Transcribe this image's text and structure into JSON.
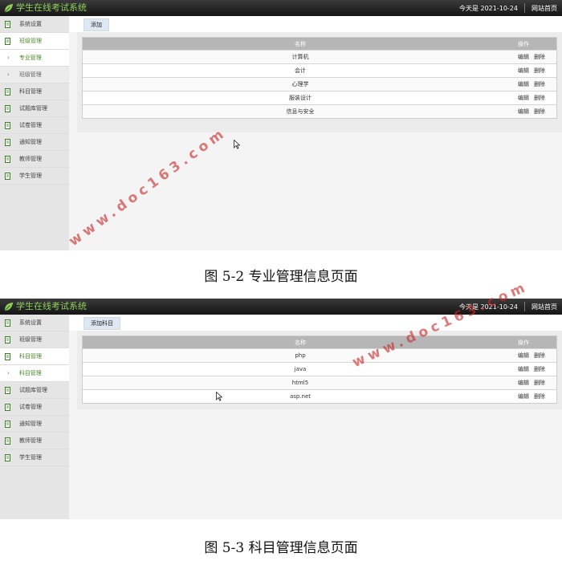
{
  "app": {
    "title": "学生在线考试系统",
    "date_text": "今天是 2021-10-24",
    "home_link": "网站首页",
    "accent_color": "#8fd05b"
  },
  "figure1": {
    "sidebar": [
      {
        "label": "系统设置",
        "icon": "document-icon",
        "kind": "item"
      },
      {
        "label": "班级管理",
        "icon": "document-icon",
        "kind": "item-active"
      },
      {
        "label": "专业管理",
        "icon": "chevron-right-icon",
        "kind": "sub-active"
      },
      {
        "label": "班级管理",
        "icon": "chevron-right-icon",
        "kind": "sub"
      },
      {
        "label": "科目管理",
        "icon": "document-icon",
        "kind": "item"
      },
      {
        "label": "试题库管理",
        "icon": "document-icon",
        "kind": "item"
      },
      {
        "label": "试卷管理",
        "icon": "document-icon",
        "kind": "item"
      },
      {
        "label": "通知管理",
        "icon": "document-icon",
        "kind": "item"
      },
      {
        "label": "教师管理",
        "icon": "document-icon",
        "kind": "item"
      },
      {
        "label": "学生管理",
        "icon": "document-icon",
        "kind": "item"
      }
    ],
    "add_button": "添加",
    "table": {
      "col_name": "名称",
      "col_op": "操作",
      "edit": "编辑",
      "delete": "删除",
      "rows": [
        "计算机",
        "会计",
        "心理学",
        "服装设计",
        "信息与安全"
      ]
    },
    "caption": "图 5-2 专业管理信息页面"
  },
  "figure2": {
    "sidebar": [
      {
        "label": "系统设置",
        "icon": "document-icon",
        "kind": "item"
      },
      {
        "label": "班级管理",
        "icon": "document-icon",
        "kind": "item"
      },
      {
        "label": "科目管理",
        "icon": "document-icon",
        "kind": "item-active"
      },
      {
        "label": "科目管理",
        "icon": "chevron-right-icon",
        "kind": "sub-active"
      },
      {
        "label": "试题库管理",
        "icon": "document-icon",
        "kind": "item"
      },
      {
        "label": "试卷管理",
        "icon": "document-icon",
        "kind": "item"
      },
      {
        "label": "通知管理",
        "icon": "document-icon",
        "kind": "item"
      },
      {
        "label": "教师管理",
        "icon": "document-icon",
        "kind": "item"
      },
      {
        "label": "学生管理",
        "icon": "document-icon",
        "kind": "item"
      }
    ],
    "add_button": "添加科目",
    "table": {
      "col_name": "名称",
      "col_op": "操作",
      "edit": "编辑",
      "delete": "删除",
      "rows": [
        "php",
        "java",
        "html5",
        "asp.net"
      ]
    },
    "caption": "图 5-3 科目管理信息页面"
  },
  "watermark": "www.doc163.com"
}
